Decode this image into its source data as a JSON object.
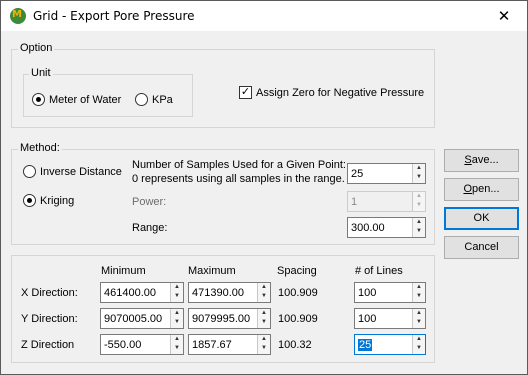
{
  "window": {
    "title": "Grid - Export Pore Pressure",
    "close_glyph": "✕",
    "icon": "miner-app-icon"
  },
  "option": {
    "label": "Option",
    "unit": {
      "label": "Unit",
      "meter_of_water": "Meter of Water",
      "kpa": "KPa",
      "selected": "Meter of Water"
    },
    "assign_zero": {
      "label": "Assign Zero for Negative Pressure",
      "checked": true
    }
  },
  "method": {
    "label": "Method:",
    "inverse_distance": "Inverse Distance",
    "kriging": "Kriging",
    "selected": "Kriging",
    "samples_line1": "Number of Samples Used for a Given Point:",
    "samples_line2": "0 represents using all samples in the range.",
    "samples_value": "25",
    "power_label": "Power:",
    "power_value": "1",
    "range_label": "Range:",
    "range_value": "300.00"
  },
  "grid": {
    "headers": {
      "minimum": "Minimum",
      "maximum": "Maximum",
      "spacing": "Spacing",
      "lines": "# of Lines"
    },
    "rows": [
      {
        "label": "X Direction:",
        "minimum": "461400.00",
        "maximum": "471390.00",
        "spacing": "100.909",
        "lines": "100"
      },
      {
        "label": "Y Direction:",
        "minimum": "9070005.00",
        "maximum": "9079995.00",
        "spacing": "100.909",
        "lines": "100"
      },
      {
        "label": "Z Direction",
        "minimum": "-550.00",
        "maximum": "1857.67",
        "spacing": "100.32",
        "lines": "25"
      }
    ]
  },
  "buttons": {
    "save": {
      "pre": "",
      "mnemonic": "S",
      "post": "ave..."
    },
    "open": {
      "pre": "",
      "mnemonic": "O",
      "post": "pen..."
    },
    "ok": "OK",
    "cancel": "Cancel"
  }
}
